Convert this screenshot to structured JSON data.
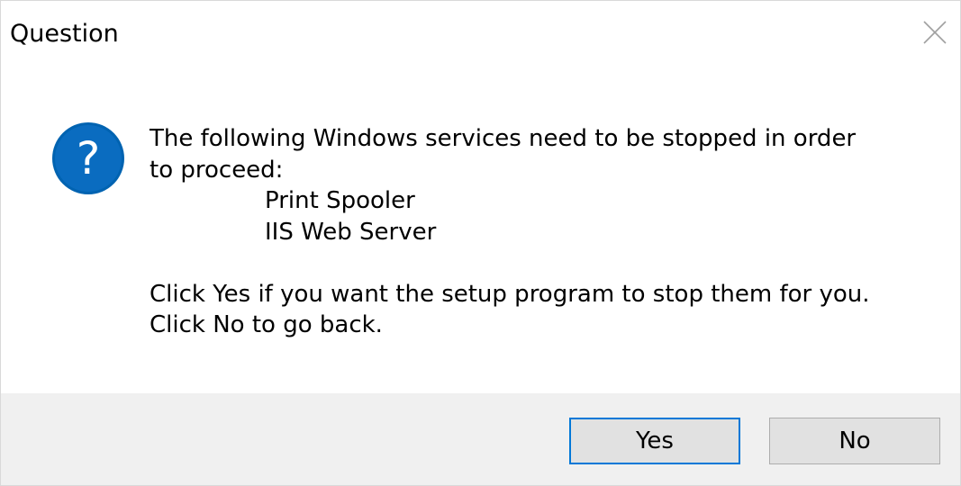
{
  "window": {
    "title": "Question",
    "close_icon": "close-icon"
  },
  "dialog": {
    "icon": "question-icon",
    "accent_color": "#0063b1",
    "message_lines": [
      "The following Windows services need to be stopped in order",
      "to proceed:"
    ],
    "services": [
      "Print Spooler",
      "IIS Web Server"
    ],
    "instructions": [
      "Click Yes if you want the setup program to stop them for you.",
      "Click No to go back."
    ]
  },
  "buttons": {
    "yes_label": "Yes",
    "no_label": "No",
    "default_border_color": "#0078d7"
  }
}
